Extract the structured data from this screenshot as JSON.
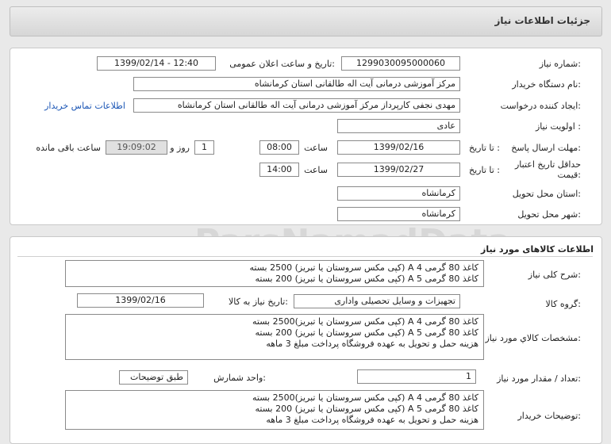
{
  "header": {
    "title": "جزئیات اطلاعات نیاز"
  },
  "watermark": {
    "text": "ParsNamadData"
  },
  "info": {
    "need_number_label": "شماره نیاز:",
    "need_number": "1299030095000060",
    "announce_label": "تاریخ و ساعت اعلان عمومی:",
    "announce_value": "1399/02/14 - 12:40",
    "buyer_label": "نام دستگاه خریدار:",
    "buyer": "مرکز آموزشی درمانی آیت اله طالقانی استان کرمانشاه",
    "creator_label": "ایجاد کننده درخواست:",
    "creator": "مهدی نجفی کارپرداز مرکز آموزشی درمانی آیت اله طالقانی استان کرمانشاه",
    "contact_link": "اطلاعات تماس خریدار",
    "priority_label": "اولویت نیاز :",
    "priority": "عادی",
    "deadline_label": "مهلت ارسال پاسخ:",
    "to_date_label": "تا تاریخ :",
    "deadline_date": "1399/02/16",
    "time_label": "ساعت",
    "deadline_time": "08:00",
    "days": "1",
    "days_label": "روز و",
    "remaining_time": "19:09:02",
    "remaining_label": "ساعت باقی مانده",
    "validity_label_1": "حداقل تاریخ اعتبار",
    "validity_label_2": "قیمت:",
    "validity_to_label": "تا تاریخ :",
    "validity_date": "1399/02/27",
    "validity_time_label": "ساعت",
    "validity_time": "14:00",
    "province_label": "استان محل تحویل:",
    "province": "کرمانشاه",
    "city_label": "شهر محل تحویل:",
    "city": "کرمانشاه"
  },
  "goods": {
    "section_title": "اطلاعات کالاهای مورد نیاز",
    "summary_label": "شرح کلی نیاز:",
    "summary_lines": [
      "کاغذ 80 گرمی A 4 (کپی مکس سروستان یا تبریز) 2500  بسته",
      "کاغذ 80 گرمی A 5 (کپی مکس سروستان یا تبریز) 200    بسته"
    ],
    "group_label": "گروه کالا:",
    "group": "تجهیزات و وسایل تحصیلی واداری",
    "need_date_label": "تاریخ نیاز به کالا:",
    "need_date": "1399/02/16",
    "spec_label": "مشخصات کالاي مورد نياز:",
    "spec_lines": [
      "کاغذ 80 گرمی A 4 (کپی مکس سروستان یا تبریز)2500  بسته",
      "کاغذ 80 گرمی A 5 (کپی مکس سروستان یا تبریز)  200    بسته",
      "هزینه حمل و تحویل به عهده فروشگاه پرداخت مبلغ 3 ماهه"
    ],
    "qty_label": "تعداد / مقدار مورد نیاز:",
    "qty": "1",
    "unit_label": "واحد شمارش:",
    "unit": "طبق توضیحات",
    "buyer_notes_label": "توضیحات خریدار:",
    "buyer_notes_lines": [
      "کاغذ 80 گرمی A 4 (کپی مکس سروستان یا تبریز)2500  بسته",
      "کاغذ 80 گرمی A 5 (کپی مکس سروستان یا تبریز)  200    بسته",
      "هزینه حمل و تحویل به عهده فروشگاه پرداخت مبلغ 3 ماهه"
    ]
  }
}
